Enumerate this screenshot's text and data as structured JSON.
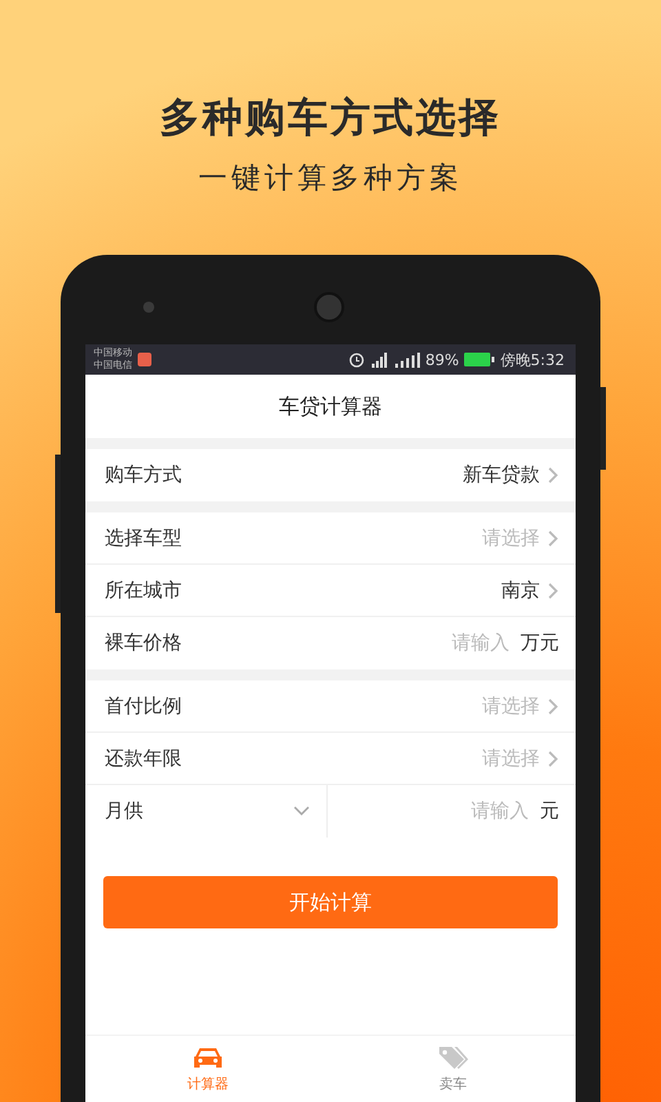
{
  "headline": "多种购车方式选择",
  "subheadline": "一键计算多种方案",
  "status_bar": {
    "carriers": [
      "中国移动",
      "中国电信"
    ],
    "battery": "89%",
    "time": "傍晚5:32"
  },
  "app_title": "车贷计算器",
  "sections": [
    [
      {
        "kind": "select",
        "label": "购车方式",
        "value": "新车贷款"
      }
    ],
    [
      {
        "kind": "select",
        "label": "选择车型",
        "placeholder": "请选择"
      },
      {
        "kind": "select",
        "label": "所在城市",
        "value": "南京"
      },
      {
        "kind": "input",
        "label": "裸车价格",
        "placeholder": "请输入",
        "unit": "万元"
      }
    ],
    [
      {
        "kind": "select",
        "label": "首付比例",
        "placeholder": "请选择"
      },
      {
        "kind": "select",
        "label": "还款年限",
        "placeholder": "请选择"
      },
      {
        "kind": "dropdown_input",
        "label": "月供",
        "placeholder": "请输入",
        "unit": "元"
      }
    ]
  ],
  "primary_button": "开始计算",
  "tabs": [
    {
      "kind": "car",
      "label": "计算器",
      "selected": true
    },
    {
      "kind": "tag",
      "label": "卖车",
      "selected": false
    }
  ]
}
